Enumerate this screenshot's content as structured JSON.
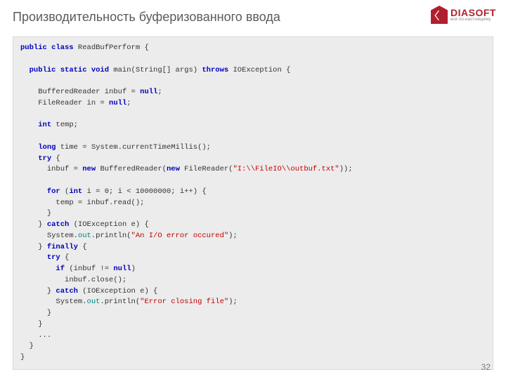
{
  "header": {
    "title": "Производительность буферизованного ввода",
    "logo_main": "DIASOFT",
    "logo_sub": "всё по-настоящему"
  },
  "code": {
    "l1_a": "public class",
    "l1_b": " ReadBufPerform {",
    "l2_a": "public static void",
    "l2_b": " main(String[] args) ",
    "l2_c": "throws",
    "l2_d": " IOException {",
    "l3": "BufferedReader inbuf = ",
    "l3_b": "null",
    "l3_c": ";",
    "l4": "FileReader in = ",
    "l4_b": "null",
    "l4_c": ";",
    "l5_a": "int",
    "l5_b": " temp;",
    "l6_a": "long",
    "l6_b": " time = System.currentTimeMillis();",
    "l7_a": "try",
    "l7_b": " {",
    "l8_a": "inbuf = ",
    "l8_b": "new",
    "l8_c": " BufferedReader(",
    "l8_d": "new",
    "l8_e": " FileReader(",
    "l8_f": "\"I:\\\\FileIO\\\\outbuf.txt\"",
    "l8_g": "));",
    "l9_a": "for",
    "l9_b": " (",
    "l9_c": "int",
    "l9_d": " i = 0; i < 10000000; i++) {",
    "l10": "temp = inbuf.read();",
    "l11": "}",
    "l12_a": "} ",
    "l12_b": "catch",
    "l12_c": " (IOException e) {",
    "l13_a": "System.",
    "l13_b": "out",
    "l13_c": ".println(",
    "l13_d": "\"An I/O error occured\"",
    "l13_e": ");",
    "l14_a": "} ",
    "l14_b": "finally",
    "l14_c": " {",
    "l15_a": "try",
    "l15_b": " {",
    "l16_a": "if",
    "l16_b": " (inbuf != ",
    "l16_c": "null",
    "l16_d": ")",
    "l17": "inbuf.close();",
    "l18_a": "} ",
    "l18_b": "catch",
    "l18_c": " (IOException e) {",
    "l19_a": "System.",
    "l19_b": "out",
    "l19_c": ".println(",
    "l19_d": "\"Error closing file\"",
    "l19_e": ");",
    "l20": "}",
    "l21": "}",
    "l22": "...",
    "l23": "}",
    "l24": "}"
  },
  "page_number": "32"
}
